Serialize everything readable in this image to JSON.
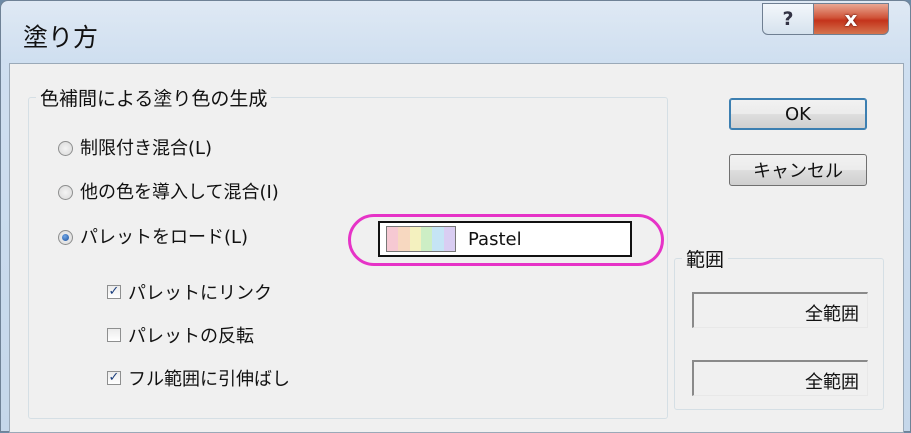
{
  "window": {
    "title": "塗り方",
    "help_glyph": "?",
    "close_glyph": "x"
  },
  "group_interp": {
    "label": "色補間による塗り色の生成",
    "radios": [
      {
        "label": "制限付き混合(L)",
        "checked": false
      },
      {
        "label": "他の色を導入して混合(I)",
        "checked": false
      },
      {
        "label": "パレットをロード(L)",
        "checked": true
      }
    ],
    "palette": {
      "name": "Pastel",
      "swatch_colors": [
        "#f6c9d3",
        "#f7d8c0",
        "#f4f1bf",
        "#cdeec5",
        "#c5e4f5",
        "#d9cdf2"
      ]
    },
    "checkboxes": [
      {
        "label": "パレットにリンク",
        "checked": true
      },
      {
        "label": "パレットの反転",
        "checked": false
      },
      {
        "label": "フル範囲に引伸ばし",
        "checked": true
      }
    ]
  },
  "buttons": {
    "ok": "OK",
    "cancel": "キャンセル"
  },
  "group_range": {
    "label": "範囲",
    "field1": "全範囲",
    "field2": "全範囲"
  },
  "check_glyph": "✓"
}
